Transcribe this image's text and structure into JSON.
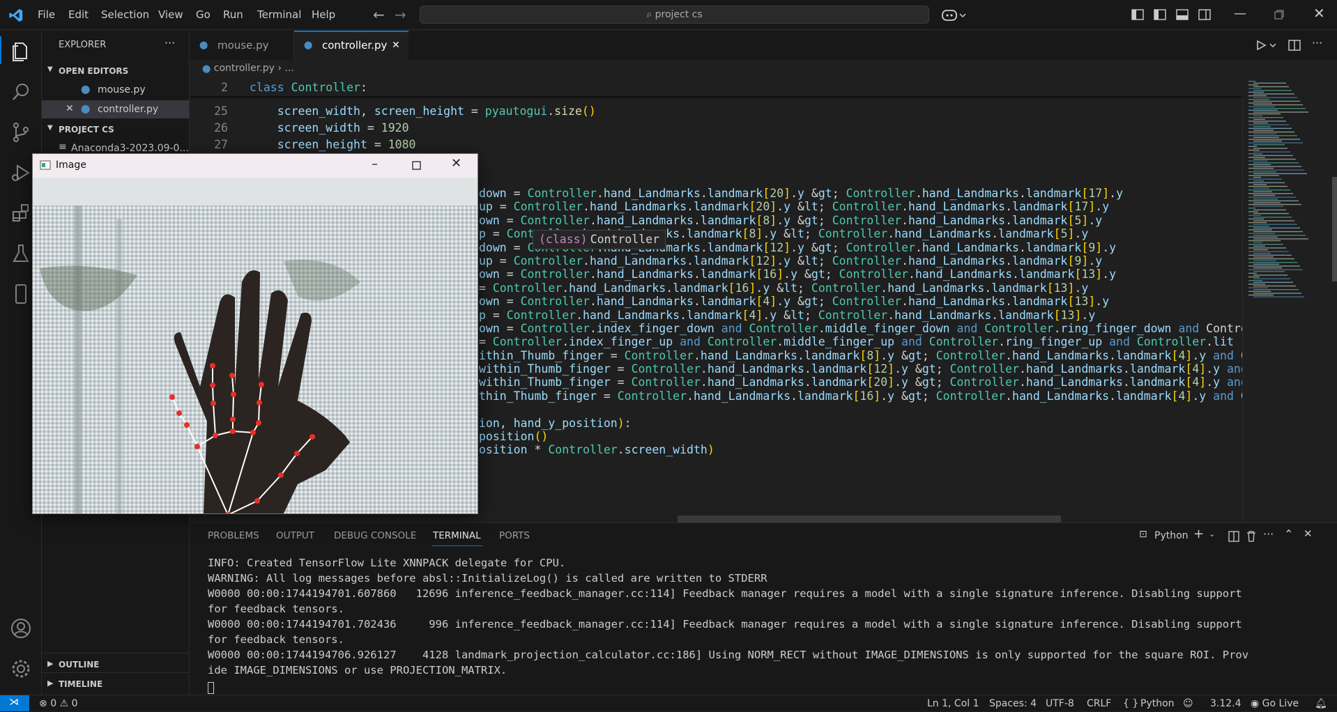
{
  "menu": [
    "File",
    "Edit",
    "Selection",
    "View",
    "Go",
    "Run",
    "Terminal",
    "Help"
  ],
  "command_center": "project cs",
  "explorer": {
    "title": "EXPLORER",
    "open_editors_label": "OPEN EDITORS",
    "open_editors": [
      "mouse.py",
      "controller.py"
    ],
    "project_label": "PROJECT CS",
    "project_items": [
      "Anaconda3-2023.09-0..."
    ],
    "outline_label": "OUTLINE",
    "timeline_label": "TIMELINE"
  },
  "tabs": [
    "mouse.py",
    "controller.py"
  ],
  "breadcrumb": {
    "file": "controller.py",
    "rest": "..."
  },
  "sticky": {
    "line": "2",
    "keyword": "class",
    "name": "Controller",
    "colon": ":"
  },
  "hover": {
    "kind": "(class)",
    "name": "Controller"
  },
  "code_lines": [
    {
      "n": "25",
      "t": "    screen_width, screen_height = pyautogui.size()"
    },
    {
      "n": "26",
      "t": "    screen_width = 1920"
    },
    {
      "n": "27",
      "t": "    screen_height = 1080"
    }
  ],
  "visible_code": [
    "down = Controller.hand_Landmarks.landmark[20].y > Controller.hand_Landmarks.landmark[17].y",
    "up = Controller.hand_Landmarks.landmark[20].y < Controller.hand_Landmarks.landmark[17].y",
    "own = Controller.hand_Landmarks.landmark[8].y > Controller.hand_Landmarks.landmark[5].y",
    "p = Controller.hand_Landmarks.landmark[8].y < Controller.hand_Landmarks.landmark[5].y",
    "down = Controller.hand_Landmarks.landmark[12].y > Controller.hand_Landmarks.landmark[9].y",
    "up = Controller.hand_Landmarks.landmark[12].y < Controller.hand_Landmarks.landmark[9].y",
    "own = Controller.hand_Landmarks.landmark[16].y > Controller.hand_Landmarks.landmark[13].y",
    "= Controller.hand_Landmarks.landmark[16].y < Controller.hand_Landmarks.landmark[13].y",
    "own = Controller.hand_Landmarks.landmark[4].y > Controller.hand_Landmarks.landmark[13].y",
    "p = Controller.hand_Landmarks.landmark[4].y < Controller.hand_Landmarks.landmark[13].y",
    "own = Controller.index_finger_down and Controller.middle_finger_down and Controller.ring_finger_down and Contro",
    "= Controller.index_finger_up and Controller.middle_finger_up and Controller.ring_finger_up and Controller.lit",
    "ithin_Thumb_finger = Controller.hand_Landmarks.landmark[8].y > Controller.hand_Landmarks.landmark[4].y and Con",
    "within_Thumb_finger = Controller.hand_Landmarks.landmark[12].y > Controller.hand_Landmarks.landmark[4].y and C",
    "within_Thumb_finger = Controller.hand_Landmarks.landmark[20].y > Controller.hand_Landmarks.landmark[4].y and C",
    "thin_Thumb_finger = Controller.hand_Landmarks.landmark[16].y > Controller.hand_Landmarks.landmark[4].y and Con",
    "",
    "ion, hand_y_position):",
    "position()",
    "osition * Controller.screen_width)"
  ],
  "panel": {
    "tabs": [
      "PROBLEMS",
      "OUTPUT",
      "DEBUG CONSOLE",
      "TERMINAL",
      "PORTS"
    ],
    "active": "TERMINAL",
    "shell": "Python",
    "lines": [
      "INFO: Created TensorFlow Lite XNNPACK delegate for CPU.",
      "WARNING: All log messages before absl::InitializeLog() is called are written to STDERR",
      "W0000 00:00:1744194701.607860   12696 inference_feedback_manager.cc:114] Feedback manager requires a model with a single signature inference. Disabling support",
      "for feedback tensors.",
      "W0000 00:00:1744194701.702436     996 inference_feedback_manager.cc:114] Feedback manager requires a model with a single signature inference. Disabling support",
      "for feedback tensors.",
      "W0000 00:00:1744194706.926127    4128 landmark_projection_calculator.cc:186] Using NORM_RECT without IMAGE_DIMENSIONS is only supported for the square ROI. Prov",
      "ide IMAGE_DIMENSIONS or use PROJECTION_MATRIX."
    ]
  },
  "status": {
    "errors": "0",
    "warnings": "0",
    "position": "Ln 1, Col 1",
    "spaces": "Spaces: 4",
    "encoding": "UTF-8",
    "eol": "CRLF",
    "language": "Python",
    "version": "3.12.4",
    "golive": "Go Live"
  },
  "image_window": {
    "title": "Image"
  },
  "colors": {
    "accent": "#0078d4",
    "keyword": "#569cd6",
    "class": "#4ec9b0",
    "function": "#dcdcaa",
    "variable": "#9cdcfe",
    "number": "#b5cea8",
    "landmark": "#e8302a"
  }
}
